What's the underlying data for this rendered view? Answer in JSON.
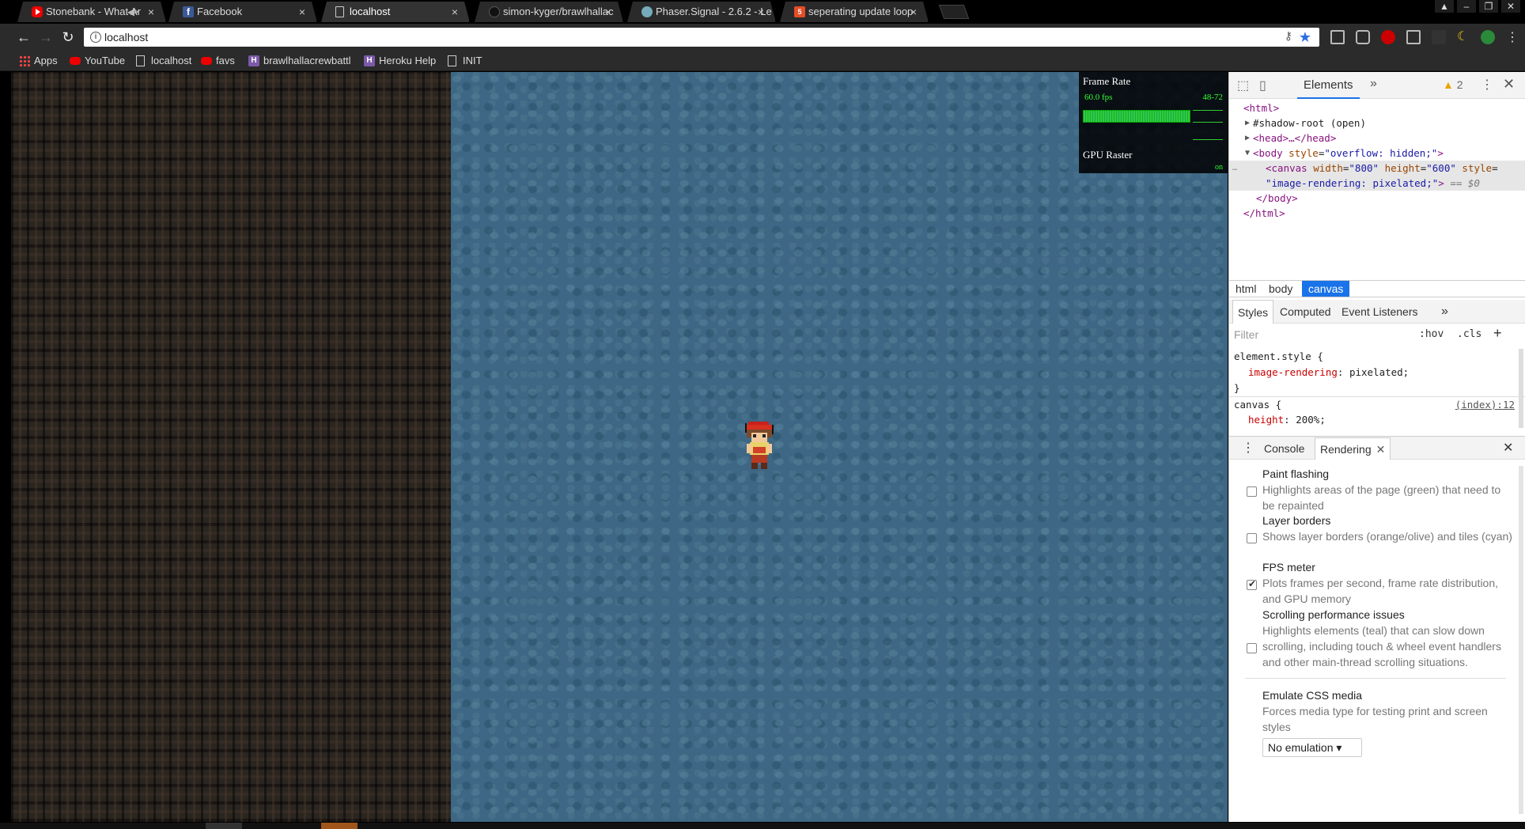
{
  "tabs": [
    {
      "title": "Stonebank - What Ar",
      "icon": "youtube-icon",
      "muted": true
    },
    {
      "title": "Facebook",
      "icon": "facebook-icon"
    },
    {
      "title": "localhost",
      "icon": "document-icon",
      "active": true
    },
    {
      "title": "simon-kyger/brawlhallac",
      "icon": "github-icon"
    },
    {
      "title": "Phaser.Signal - 2.6.2 - Le",
      "icon": "phaser-icon"
    },
    {
      "title": "seperating update loop",
      "icon": "html5-icon"
    }
  ],
  "omnibox": {
    "url": "localhost"
  },
  "bookmarks": [
    {
      "label": "Apps",
      "icon": "apps-grid-icon"
    },
    {
      "label": "YouTube",
      "icon": "youtube-icon"
    },
    {
      "label": "localhost",
      "icon": "document-icon"
    },
    {
      "label": "favs",
      "icon": "youtube-icon"
    },
    {
      "label": "brawlhallacrewbattle",
      "icon": "heroku-icon"
    },
    {
      "label": "Heroku Help",
      "icon": "heroku-icon"
    },
    {
      "label": "INIT",
      "icon": "document-icon"
    }
  ],
  "fps_meter": {
    "title": "Frame Rate",
    "fps": "60.0 fps",
    "range": "48-72",
    "gpu_label": "GPU Raster",
    "gpu_state": "on"
  },
  "devtools": {
    "main_tab": "Elements",
    "warnings": "2",
    "dom": {
      "html_open": "<html>",
      "shadow_root": "#shadow-root (open)",
      "head": "<head>…</head>",
      "body_tag": "<body",
      "body_attr": "style",
      "body_val": "\"overflow: hidden;\"",
      "canvas_tag": "<canvas",
      "canvas_width_attr": "width",
      "canvas_width_val": "\"800\"",
      "canvas_height_attr": "height",
      "canvas_height_val": "\"600\"",
      "canvas_style_attr": "style",
      "canvas_style_val": "\"image-rendering: pixelated;\"",
      "canvas_ref": "== $0",
      "body_close": "</body>",
      "html_close": "</html>"
    },
    "breadcrumbs": [
      "html",
      "body",
      "canvas"
    ],
    "style_tabs": [
      "Styles",
      "Computed",
      "Event Listeners"
    ],
    "filter_placeholder": "Filter",
    "hov": ":hov",
    "cls": ".cls",
    "rules": {
      "element_selector": "element.style {",
      "element_prop": "image-rendering",
      "element_val": "pixelated;",
      "close": "}",
      "canvas_selector": "canvas {",
      "canvas_link": "(index):12",
      "canvas_prop": "height",
      "canvas_val": "200%;"
    },
    "drawer_tabs": [
      "Console",
      "Rendering"
    ],
    "rendering": [
      {
        "title": "Paint flashing",
        "desc": "Highlights areas of the page (green) that need to be repainted",
        "checked": false
      },
      {
        "title": "Layer borders",
        "desc": "Shows layer borders (orange/olive) and tiles (cyan)",
        "checked": false
      },
      {
        "title": "FPS meter",
        "desc": "Plots frames per second, frame rate distribution, and GPU memory",
        "checked": true
      },
      {
        "title": "Scrolling performance issues",
        "desc": "Highlights elements (teal) that can slow down scrolling, including touch & wheel event handlers and other main-thread scrolling situations.",
        "checked": false
      }
    ],
    "emulate": {
      "title": "Emulate CSS media",
      "desc": "Forces media type for testing print and screen styles",
      "select": "No emulation"
    }
  },
  "colors": {
    "accent": "#1a73e8",
    "water": "#3d6784",
    "dirt": "#2b2520",
    "fps_green": "#33ff33"
  }
}
